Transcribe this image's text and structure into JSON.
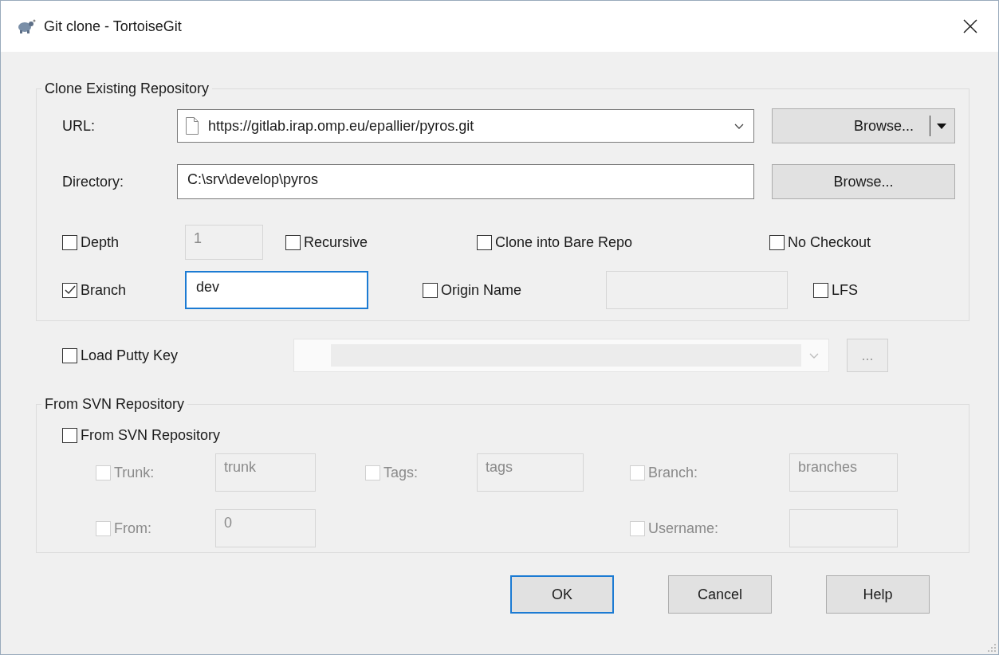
{
  "window": {
    "title": "Git clone - TortoiseGit"
  },
  "clone_group": {
    "title": "Clone Existing Repository",
    "rows": [
      {
        "items": [
          {
            "kind": "label",
            "text": "URL:"
          },
          {
            "kind": "combo",
            "value": "https://gitlab.irap.omp.eu/epallier/pyros.git",
            "disabled": false
          },
          {
            "kind": "split_button",
            "text": "Browse..."
          }
        ]
      },
      {
        "items": [
          {
            "kind": "label",
            "text": "Directory:"
          },
          {
            "kind": "field",
            "value": "C:\\srv\\develop\\pyros",
            "disabled": false,
            "focused": false
          },
          {
            "kind": "button",
            "text": "Browse...",
            "disabled": false
          }
        ]
      },
      {
        "items": [
          {
            "kind": "checkbox",
            "label": "Depth",
            "checked": false,
            "disabled": false
          },
          {
            "kind": "field",
            "value": "1",
            "disabled": true,
            "focused": false
          },
          {
            "kind": "checkbox",
            "label": "Recursive",
            "checked": false,
            "disabled": false
          },
          {
            "kind": "checkbox",
            "label": "Clone into Bare Repo",
            "checked": false,
            "disabled": false
          },
          {
            "kind": "checkbox",
            "label": "No Checkout",
            "checked": false,
            "disabled": false
          }
        ]
      },
      {
        "items": [
          {
            "kind": "checkbox",
            "label": "Branch",
            "checked": true,
            "disabled": false
          },
          {
            "kind": "field",
            "value": "dev",
            "disabled": false,
            "focused": true
          },
          {
            "kind": "checkbox",
            "label": "Origin Name",
            "checked": false,
            "disabled": false
          },
          {
            "kind": "field",
            "disabled": true,
            "focused": false
          },
          {
            "kind": "checkbox",
            "label": "LFS",
            "checked": false,
            "disabled": false
          }
        ]
      }
    ]
  },
  "putty_row": {
    "items": [
      {
        "kind": "checkbox",
        "label": "Load Putty Key",
        "checked": false,
        "disabled": false
      },
      {
        "kind": "combo",
        "disabled": true
      },
      {
        "kind": "button",
        "text": "...",
        "disabled": true
      }
    ]
  },
  "svn_group": {
    "title": "From SVN Repository",
    "rows": [
      {
        "items": [
          {
            "kind": "checkbox",
            "label": "From SVN Repository",
            "checked": false,
            "disabled": false
          }
        ]
      },
      {
        "items": [
          {
            "kind": "checkbox",
            "label": "Trunk:",
            "checked": false,
            "disabled": true
          },
          {
            "kind": "field",
            "value": "trunk",
            "disabled": true,
            "focused": false
          },
          {
            "kind": "checkbox",
            "label": "Tags:",
            "checked": false,
            "disabled": true
          },
          {
            "kind": "field",
            "value": "tags",
            "disabled": true,
            "focused": false
          },
          {
            "kind": "checkbox",
            "label": "Branch:",
            "checked": false,
            "disabled": true
          },
          {
            "kind": "field",
            "value": "branches",
            "disabled": true,
            "focused": false
          }
        ]
      },
      {
        "items": [
          {
            "kind": "checkbox",
            "label": "From:",
            "checked": false,
            "disabled": true
          },
          {
            "kind": "field",
            "value": "0",
            "disabled": true,
            "focused": false
          },
          {
            "kind": "checkbox",
            "label": "Username:",
            "checked": false,
            "disabled": true
          },
          {
            "kind": "field",
            "disabled": true,
            "focused": false
          }
        ]
      }
    ]
  },
  "buttons": [
    {
      "label": "OK",
      "default": true
    },
    {
      "label": "Cancel",
      "default": false
    },
    {
      "label": "Help",
      "default": false
    }
  ]
}
